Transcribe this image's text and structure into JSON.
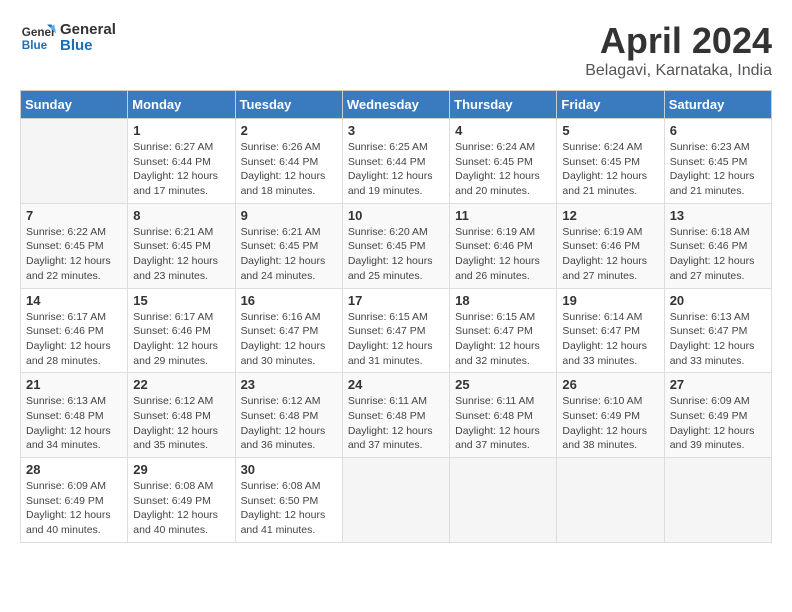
{
  "header": {
    "logo_line1": "General",
    "logo_line2": "Blue",
    "title": "April 2024",
    "subtitle": "Belagavi, Karnataka, India"
  },
  "weekdays": [
    "Sunday",
    "Monday",
    "Tuesday",
    "Wednesday",
    "Thursday",
    "Friday",
    "Saturday"
  ],
  "weeks": [
    [
      {
        "day": "",
        "info": ""
      },
      {
        "day": "1",
        "info": "Sunrise: 6:27 AM\nSunset: 6:44 PM\nDaylight: 12 hours\nand 17 minutes."
      },
      {
        "day": "2",
        "info": "Sunrise: 6:26 AM\nSunset: 6:44 PM\nDaylight: 12 hours\nand 18 minutes."
      },
      {
        "day": "3",
        "info": "Sunrise: 6:25 AM\nSunset: 6:44 PM\nDaylight: 12 hours\nand 19 minutes."
      },
      {
        "day": "4",
        "info": "Sunrise: 6:24 AM\nSunset: 6:45 PM\nDaylight: 12 hours\nand 20 minutes."
      },
      {
        "day": "5",
        "info": "Sunrise: 6:24 AM\nSunset: 6:45 PM\nDaylight: 12 hours\nand 21 minutes."
      },
      {
        "day": "6",
        "info": "Sunrise: 6:23 AM\nSunset: 6:45 PM\nDaylight: 12 hours\nand 21 minutes."
      }
    ],
    [
      {
        "day": "7",
        "info": "Sunrise: 6:22 AM\nSunset: 6:45 PM\nDaylight: 12 hours\nand 22 minutes."
      },
      {
        "day": "8",
        "info": "Sunrise: 6:21 AM\nSunset: 6:45 PM\nDaylight: 12 hours\nand 23 minutes."
      },
      {
        "day": "9",
        "info": "Sunrise: 6:21 AM\nSunset: 6:45 PM\nDaylight: 12 hours\nand 24 minutes."
      },
      {
        "day": "10",
        "info": "Sunrise: 6:20 AM\nSunset: 6:45 PM\nDaylight: 12 hours\nand 25 minutes."
      },
      {
        "day": "11",
        "info": "Sunrise: 6:19 AM\nSunset: 6:46 PM\nDaylight: 12 hours\nand 26 minutes."
      },
      {
        "day": "12",
        "info": "Sunrise: 6:19 AM\nSunset: 6:46 PM\nDaylight: 12 hours\nand 27 minutes."
      },
      {
        "day": "13",
        "info": "Sunrise: 6:18 AM\nSunset: 6:46 PM\nDaylight: 12 hours\nand 27 minutes."
      }
    ],
    [
      {
        "day": "14",
        "info": "Sunrise: 6:17 AM\nSunset: 6:46 PM\nDaylight: 12 hours\nand 28 minutes."
      },
      {
        "day": "15",
        "info": "Sunrise: 6:17 AM\nSunset: 6:46 PM\nDaylight: 12 hours\nand 29 minutes."
      },
      {
        "day": "16",
        "info": "Sunrise: 6:16 AM\nSunset: 6:47 PM\nDaylight: 12 hours\nand 30 minutes."
      },
      {
        "day": "17",
        "info": "Sunrise: 6:15 AM\nSunset: 6:47 PM\nDaylight: 12 hours\nand 31 minutes."
      },
      {
        "day": "18",
        "info": "Sunrise: 6:15 AM\nSunset: 6:47 PM\nDaylight: 12 hours\nand 32 minutes."
      },
      {
        "day": "19",
        "info": "Sunrise: 6:14 AM\nSunset: 6:47 PM\nDaylight: 12 hours\nand 33 minutes."
      },
      {
        "day": "20",
        "info": "Sunrise: 6:13 AM\nSunset: 6:47 PM\nDaylight: 12 hours\nand 33 minutes."
      }
    ],
    [
      {
        "day": "21",
        "info": "Sunrise: 6:13 AM\nSunset: 6:48 PM\nDaylight: 12 hours\nand 34 minutes."
      },
      {
        "day": "22",
        "info": "Sunrise: 6:12 AM\nSunset: 6:48 PM\nDaylight: 12 hours\nand 35 minutes."
      },
      {
        "day": "23",
        "info": "Sunrise: 6:12 AM\nSunset: 6:48 PM\nDaylight: 12 hours\nand 36 minutes."
      },
      {
        "day": "24",
        "info": "Sunrise: 6:11 AM\nSunset: 6:48 PM\nDaylight: 12 hours\nand 37 minutes."
      },
      {
        "day": "25",
        "info": "Sunrise: 6:11 AM\nSunset: 6:48 PM\nDaylight: 12 hours\nand 37 minutes."
      },
      {
        "day": "26",
        "info": "Sunrise: 6:10 AM\nSunset: 6:49 PM\nDaylight: 12 hours\nand 38 minutes."
      },
      {
        "day": "27",
        "info": "Sunrise: 6:09 AM\nSunset: 6:49 PM\nDaylight: 12 hours\nand 39 minutes."
      }
    ],
    [
      {
        "day": "28",
        "info": "Sunrise: 6:09 AM\nSunset: 6:49 PM\nDaylight: 12 hours\nand 40 minutes."
      },
      {
        "day": "29",
        "info": "Sunrise: 6:08 AM\nSunset: 6:49 PM\nDaylight: 12 hours\nand 40 minutes."
      },
      {
        "day": "30",
        "info": "Sunrise: 6:08 AM\nSunset: 6:50 PM\nDaylight: 12 hours\nand 41 minutes."
      },
      {
        "day": "",
        "info": ""
      },
      {
        "day": "",
        "info": ""
      },
      {
        "day": "",
        "info": ""
      },
      {
        "day": "",
        "info": ""
      }
    ]
  ]
}
